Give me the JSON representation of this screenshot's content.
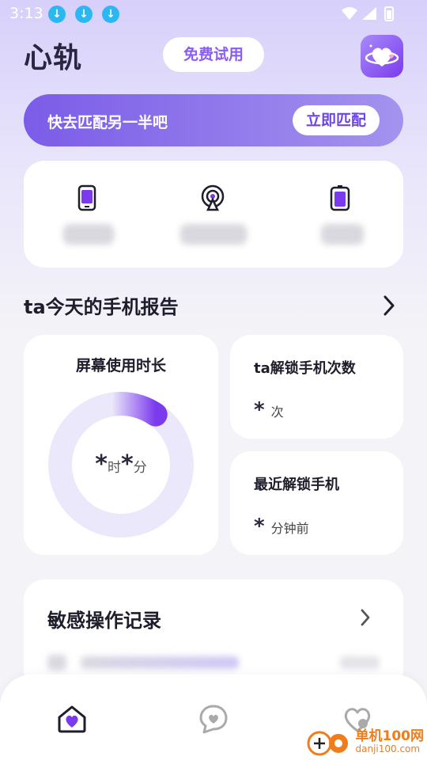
{
  "status_bar": {
    "time": "3:13"
  },
  "header": {
    "logo": "心轨",
    "free_trial": "免费试用"
  },
  "match_banner": {
    "text": "快去匹配另一半吧",
    "button": "立即匹配"
  },
  "report": {
    "title": "ta今天的手机报告",
    "screen_time": {
      "title": "屏幕使用时长",
      "hours": "*",
      "hours_unit": "时",
      "minutes": "*",
      "minutes_unit": "分",
      "progress": 0.12
    },
    "unlock_count": {
      "title": "ta解锁手机次数",
      "value": "*",
      "unit": "次"
    },
    "recent_unlock": {
      "title": "最近解锁手机",
      "value": "*",
      "unit": "分钟前"
    }
  },
  "sensitive": {
    "title": "敏感操作记录"
  },
  "colors": {
    "accent": "#7c3aed",
    "ring_bg": "#ebe8fb",
    "download": "#2bb8f2"
  },
  "watermark": {
    "line1": "单机100网",
    "line2": "danji100.com"
  }
}
